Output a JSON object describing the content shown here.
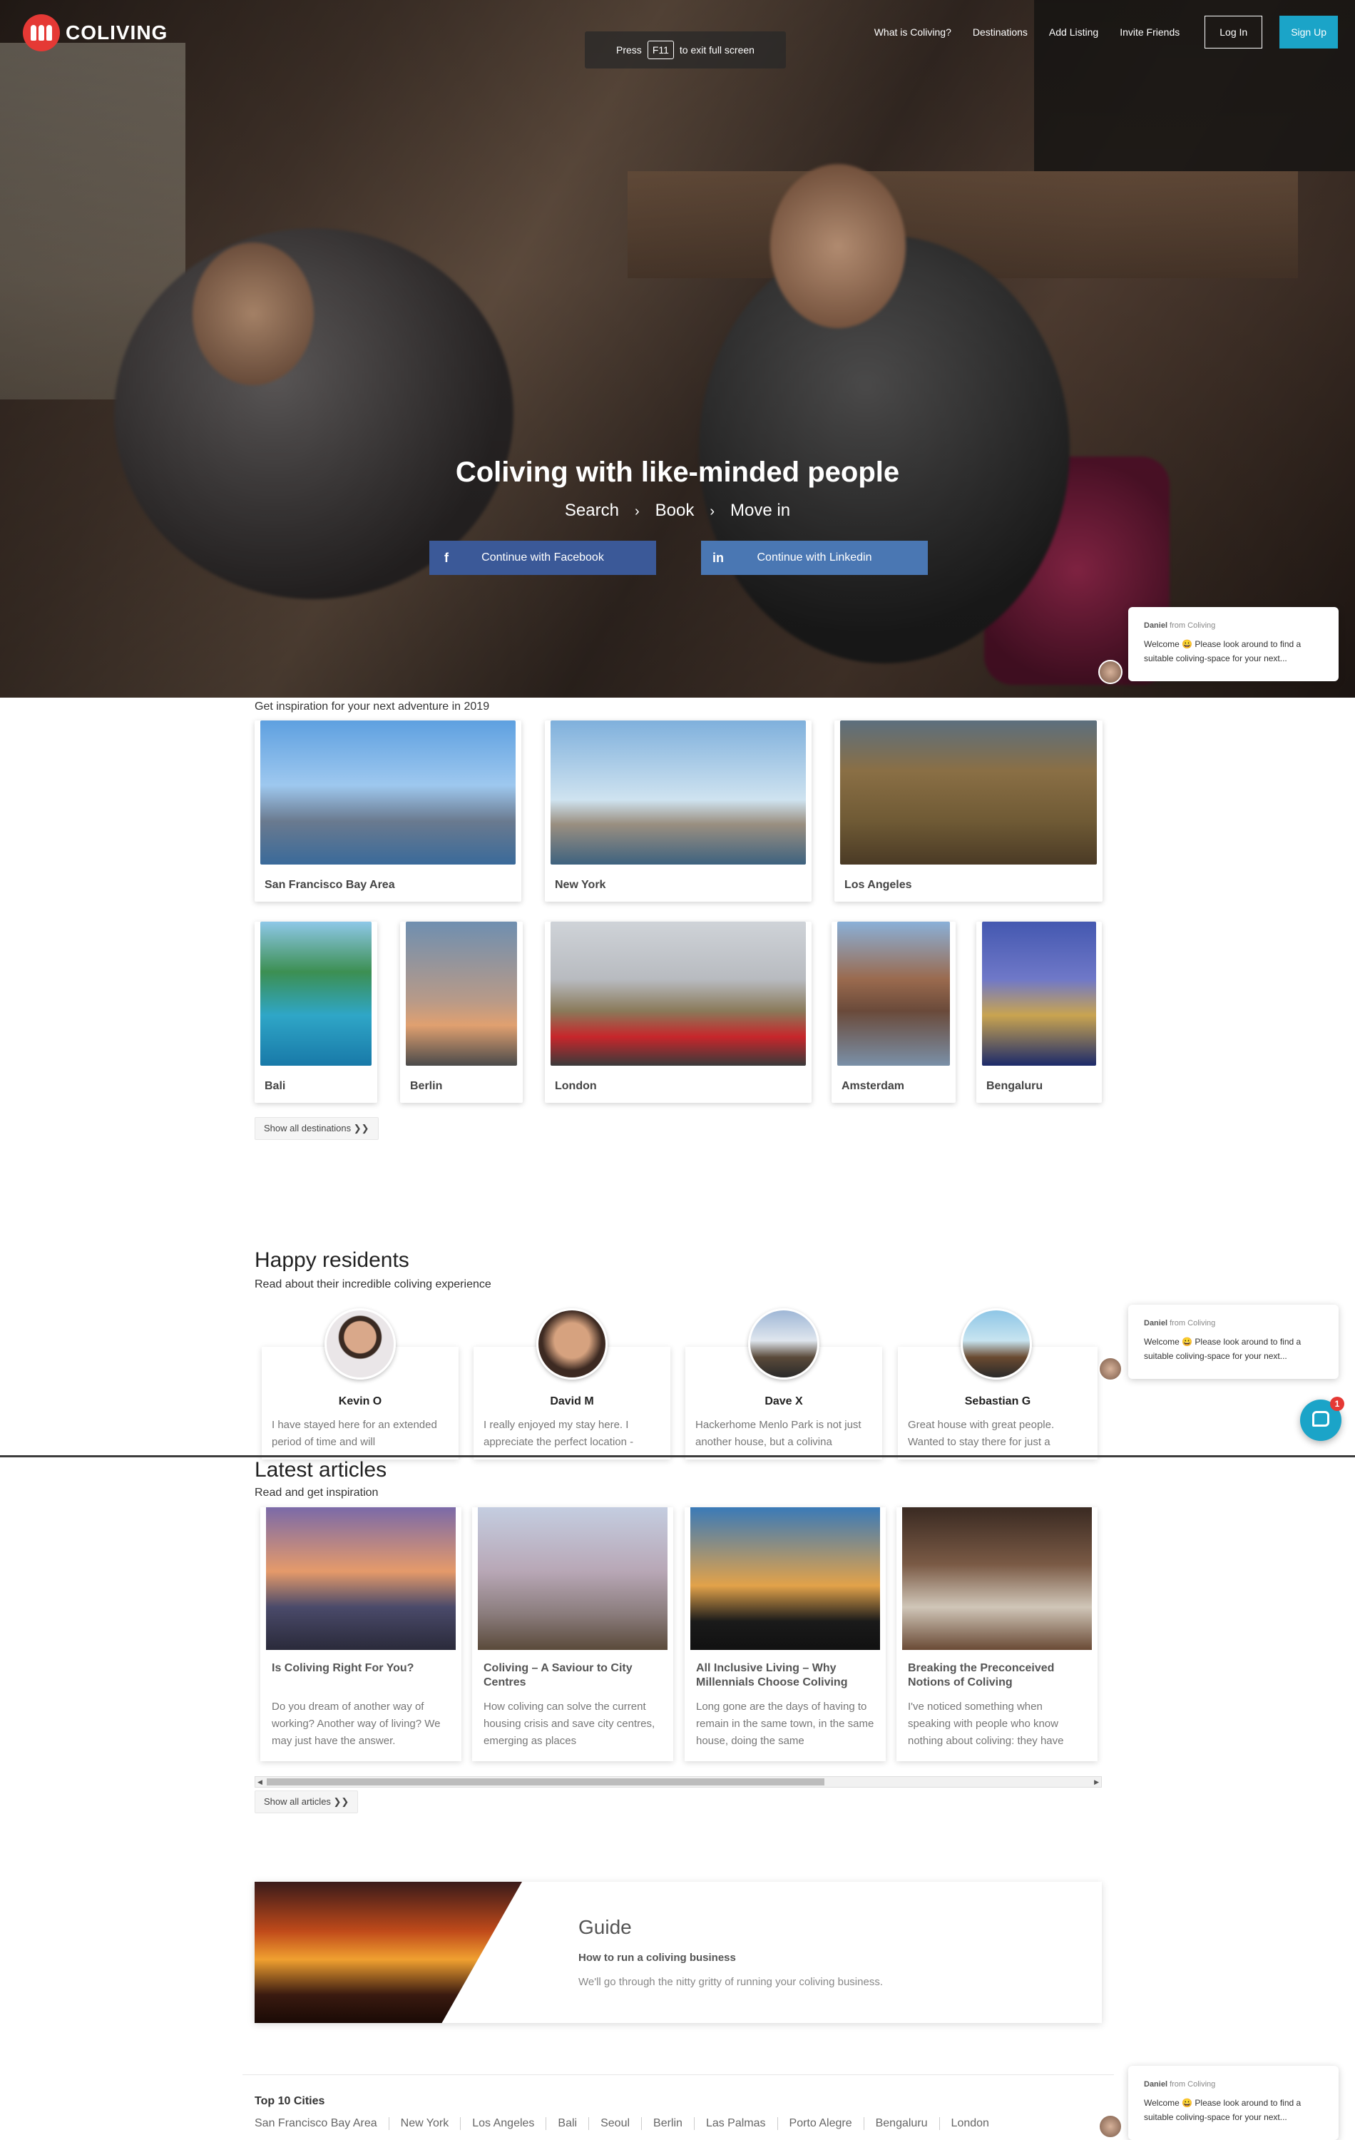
{
  "header": {
    "brand": "COLIVING",
    "f11_press": "Press",
    "f11_key": "F11",
    "f11_rest": "to exit full screen",
    "nav": [
      "What is Coliving?",
      "Destinations",
      "Add Listing",
      "Invite Friends"
    ],
    "login": "Log In",
    "signup": "Sign Up"
  },
  "hero": {
    "title": "Coliving with like-minded people",
    "steps": [
      "Search",
      "Book",
      "Move in"
    ],
    "facebook": "Continue with Facebook",
    "linkedin": "Continue with Linkedin",
    "facebook_icon": "f",
    "linkedin_icon": "in"
  },
  "chat": {
    "sender": "Daniel",
    "from": "from Coliving",
    "message": "Welcome 😀 Please look around to find a suitable coliving-space for your next..."
  },
  "inspiration": {
    "heading": "Get inspiration for your next adventure in 2019",
    "destinations": [
      "San Francisco Bay Area",
      "New York",
      "Los Angeles",
      "Bali",
      "Berlin",
      "London",
      "Amsterdam",
      "Bengaluru"
    ],
    "show_all": "Show all destinations ❯❯"
  },
  "residents": {
    "title": "Happy residents",
    "subtitle": "Read about their incredible coliving experience",
    "items": [
      {
        "name": "Kevin O",
        "text": "I have stayed here for an extended period of time and will"
      },
      {
        "name": "David M",
        "text": "I really enjoyed my stay here. I appreciate the perfect location -"
      },
      {
        "name": "Dave X",
        "text": "Hackerhome Menlo Park is not just another house, but a colivina"
      },
      {
        "name": "Sebastian G",
        "text": "Great house with great people. Wanted to stay there for just a"
      }
    ]
  },
  "articles": {
    "title": "Latest articles",
    "subtitle": "Read and get inspiration",
    "items": [
      {
        "title": "Is Coliving Right For You?",
        "text": "Do you dream of another way of working? Another way of living? We may just have the answer."
      },
      {
        "title": "Coliving – A Saviour to City Centres",
        "text": "How coliving can solve the current housing crisis and save city centres, emerging as places"
      },
      {
        "title": "All Inclusive Living – Why Millennials Choose Coliving",
        "text": "Long gone are the days of having to remain in the same town, in the same house, doing the same"
      },
      {
        "title": "Breaking the Preconceived Notions of Coliving",
        "text": "I've noticed something when speaking with people who know nothing about coliving: they have"
      }
    ],
    "show_all": "Show all articles ❯❯"
  },
  "guide": {
    "title": "Guide",
    "subtitle": "How to run a coliving business",
    "text": "We'll go through the nitty gritty of running your coliving business."
  },
  "footer": {
    "top_cities_title": "Top 10 Cities",
    "cities": [
      "San Francisco Bay Area",
      "New York",
      "Los Angeles",
      "Bali",
      "Seoul",
      "Berlin",
      "Las Palmas",
      "Porto Alegre",
      "Bengaluru",
      "London"
    ]
  },
  "intercom": {
    "badge": "1"
  }
}
